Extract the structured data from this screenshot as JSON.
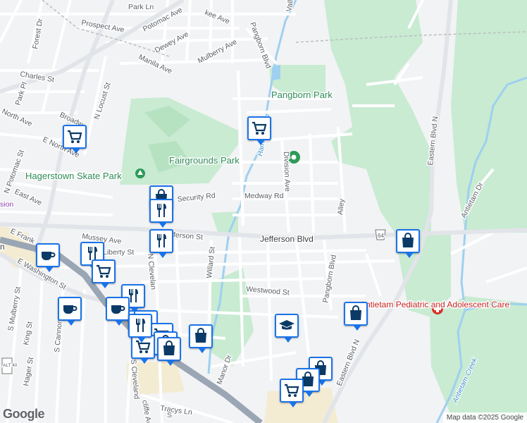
{
  "map": {
    "colors": {
      "background": "#f2f3f5",
      "park": "#c8ebd2",
      "park_dark": "#b6e2c1",
      "water": "#9fd0ef",
      "highway": "#9aa6b4",
      "major_road": "#e1e4e8",
      "road": "#ffffff",
      "marker_border": "#1a73e8",
      "marker_icon": "#0b3a66"
    },
    "labels": {
      "park_ln": "Park Ln",
      "potomac_ave": "Potomac Ave",
      "kee_ave": "kee Ave",
      "vall": "Vall",
      "forest_dr": "Forest Dr",
      "prospect_ave": "Prospect Ave",
      "dewey_ave": "Dewey Ave",
      "mulberry_ave": "Mulberry Ave",
      "pangborn_blvd_n": "Pangborn Blvd",
      "manila_ave": "Manila Ave",
      "charles_st": "Charles St",
      "park_pl": "Park Pl",
      "n_locust_st": "N Locust St",
      "pangborn_park": "Pangborn Park",
      "north_ave": "North Ave",
      "broadway": "Broadw",
      "e_north_ave": "E North Ave",
      "hamilton_run": "Hamilton Run",
      "eastern_blvd_n_top": "Eastern Blvd N",
      "n_potomac_st": "N Potomac St",
      "fairgrounds_park": "Fairgrounds Park",
      "hagerstown_skate_park": "Hagerstown Skate Park",
      "division_ave": "Division Ave",
      "antietam_dr": "Antietam Dr",
      "east_ave": "East Ave",
      "security_rd": "Security Rd",
      "medway_rd": "Medway Rd",
      "alley": "Alley",
      "mussey_ave": "Mussey Ave",
      "jefferson_st": "Jefferson St",
      "jefferson_blvd": "Jefferson Blvd",
      "route_64": "64",
      "e_frank": "E Frank",
      "liberty_st": "Liberty St",
      "willard_st": "Willard St",
      "pangborn_blvd_s": "Pangborn Blvd",
      "e_washington_st": "E Washington St",
      "westwood_st": "Westwood St",
      "antietam_pediatric": "Antietam Pediatric and Adolescent Care",
      "s_mulberry_st": "S Mulberry St",
      "s_cannon": "S Cannon",
      "king_st": "King St",
      "hager_st": "Hager St",
      "route_alt40": "ALT 40",
      "s_cleveland": "S Cleveland",
      "manor_dr": "Manor Dr",
      "eastern_blvd_n_bottom": "Eastern Blvd N",
      "antietam_creek": "Antietam Creek",
      "tracys_ln": "Tracys Ln",
      "cliffe_ave": "cliffe Ave",
      "s_ave": "S",
      "n_cleveland": "N Clevelan",
      "sion": "sion",
      "left_n": "n"
    },
    "markers": [
      {
        "type": "grocery",
        "icon": "shopping-cart-icon"
      },
      {
        "type": "grocery",
        "icon": "shopping-cart-icon"
      },
      {
        "type": "shopping",
        "icon": "shopping-bag-icon"
      },
      {
        "type": "restaurant",
        "icon": "fork-knife-icon"
      },
      {
        "type": "restaurant",
        "icon": "fork-knife-icon"
      },
      {
        "type": "cafe",
        "icon": "coffee-cup-icon"
      },
      {
        "type": "restaurant",
        "icon": "fork-knife-icon"
      },
      {
        "type": "grocery",
        "icon": "shopping-cart-icon"
      },
      {
        "type": "restaurant",
        "icon": "fork-knife-icon"
      },
      {
        "type": "cafe",
        "icon": "coffee-cup-icon"
      },
      {
        "type": "cafe",
        "icon": "coffee-cup-icon"
      },
      {
        "type": "restaurant",
        "icon": "fork-knife-icon"
      },
      {
        "type": "restaurant",
        "icon": "fork-knife-icon"
      },
      {
        "type": "shopping",
        "icon": "shopping-bag-icon"
      },
      {
        "type": "grocery",
        "icon": "shopping-cart-icon"
      },
      {
        "type": "shopping",
        "icon": "shopping-bag-icon"
      },
      {
        "type": "shopping",
        "icon": "shopping-bag-icon"
      },
      {
        "type": "grocery",
        "icon": "shopping-cart-icon"
      },
      {
        "type": "school",
        "icon": "graduation-cap-icon"
      },
      {
        "type": "restaurant",
        "icon": "fork-knife-icon"
      },
      {
        "type": "shopping",
        "icon": "shopping-bag-icon"
      },
      {
        "type": "shopping",
        "icon": "shopping-bag-icon"
      },
      {
        "type": "shopping",
        "icon": "shopping-bag-icon"
      },
      {
        "type": "shopping",
        "icon": "shopping-bag-icon"
      },
      {
        "type": "grocery",
        "icon": "shopping-cart-icon"
      }
    ],
    "logo": "Google",
    "attribution": "Map data ©2025 Google"
  }
}
